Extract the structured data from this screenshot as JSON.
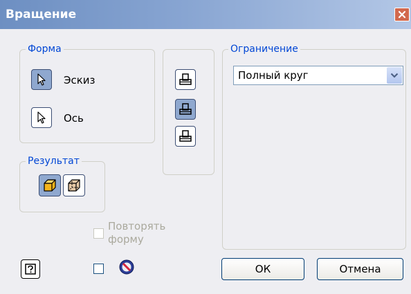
{
  "dialog": {
    "title": "Вращение",
    "close_icon": "close-icon"
  },
  "shape_group": {
    "legend": "Форма",
    "sketch_label": "Эскиз",
    "axis_label": "Ось",
    "icon": "cursor-arrow-icon"
  },
  "result_group": {
    "legend": "Результат",
    "solid_icon": "solid-body-icon",
    "surface_icon": "surface-body-icon"
  },
  "operations": {
    "icons": [
      "join-icon",
      "cut-icon",
      "intersect-icon"
    ],
    "selected_index": 1
  },
  "extents_group": {
    "legend": "Ограничение",
    "selected_value": "Полный круг"
  },
  "repeat_shape": {
    "label_line1": "Повторять",
    "label_line2": "форму",
    "checked": false,
    "enabled": false
  },
  "bottom": {
    "help_icon": "help-icon",
    "preview_checked": false,
    "no_preview_icon": "no-preview-icon",
    "ok_label": "ОК",
    "cancel_label": "Отмена"
  },
  "colors": {
    "legend_text": "#0046d5",
    "title_bar": "#7a9ccf",
    "close_button": "#d2694e",
    "button_pressed": "#8fa8cf",
    "dialog_bg": "#eeeef2"
  }
}
